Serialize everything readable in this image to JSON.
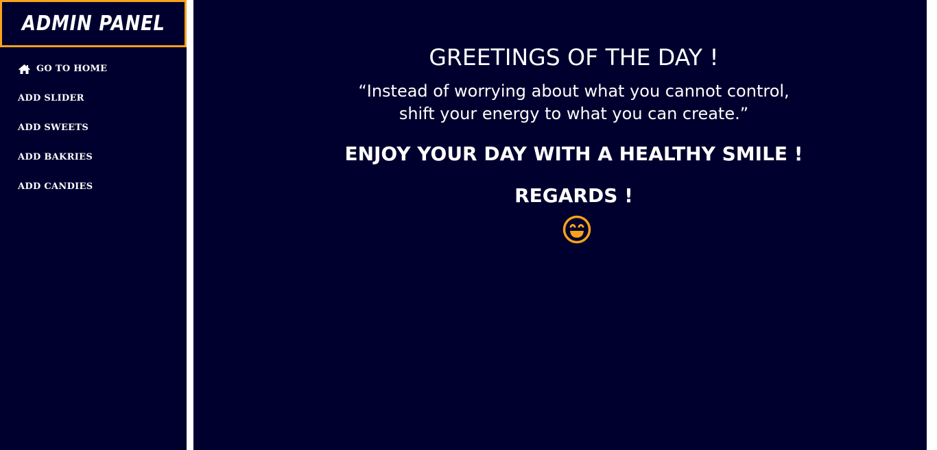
{
  "sidebar": {
    "brand": "ADMIN PANEL",
    "items": [
      {
        "label": "GO TO HOME",
        "icon": "home-icon"
      },
      {
        "label": "ADD SLIDER"
      },
      {
        "label": "ADD SWEETS"
      },
      {
        "label": "ADD BAKRIES"
      },
      {
        "label": "ADD CANDIES"
      }
    ]
  },
  "main": {
    "greeting": "GREETINGS OF THE DAY !",
    "quote_line1": "“Instead of worrying about what you cannot control,",
    "quote_line2": "shift your energy to what you can create.”",
    "enjoy": "ENJOY YOUR DAY WITH A HEALTHY SMILE !",
    "regards": "REGARDS !",
    "emoji_icon": "smile-icon"
  },
  "colors": {
    "background": "#00002e",
    "accent_border": "#f7a21b",
    "text": "#ffffff",
    "emoji": "#f7a21b"
  }
}
